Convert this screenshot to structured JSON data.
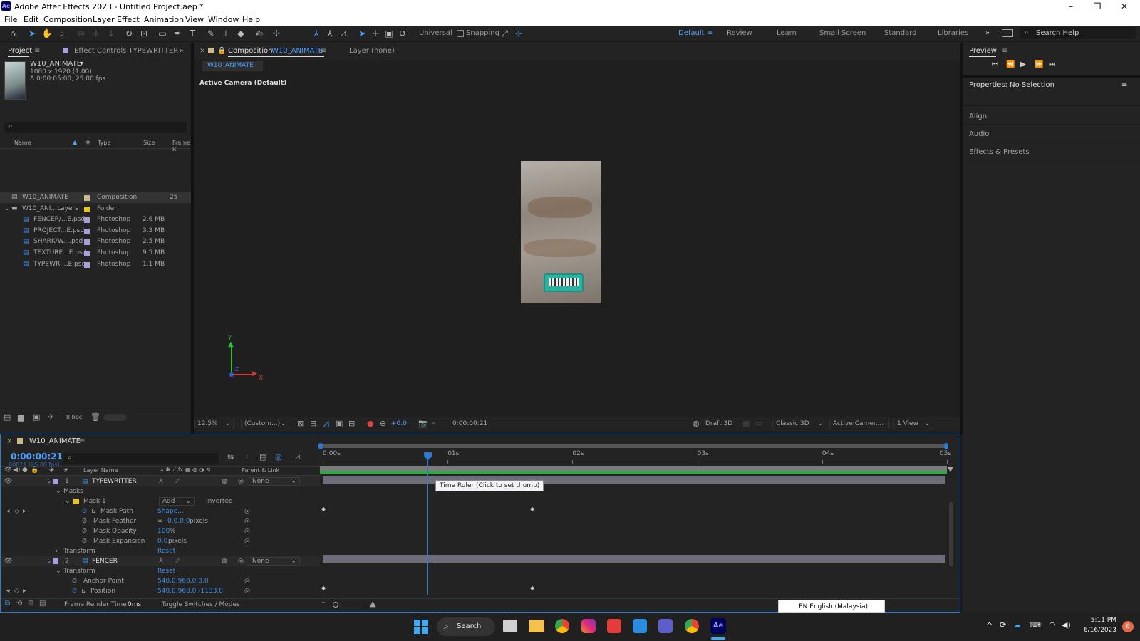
{
  "app": {
    "title": "Adobe After Effects 2023 - Untitled Project.aep *",
    "logo_text": "Ae"
  },
  "menu": [
    "File",
    "Edit",
    "Composition",
    "Layer",
    "Effect",
    "Animation",
    "View",
    "Window",
    "Help"
  ],
  "toolbar": {
    "axis_mode": "Universal",
    "snapping_label": "Snapping",
    "workspaces": [
      "Default",
      "Review",
      "Learn",
      "Small Screen",
      "Standard",
      "Libraries"
    ],
    "active_workspace": "Default",
    "search_placeholder": "Search Help"
  },
  "project_panel": {
    "tab_project": "Project",
    "tab_effect_controls": "Effect Controls TYPEWRITTER",
    "comp_name": "W10_ANIMATE",
    "comp_size": "1080 x 1920 (1.00)",
    "comp_duration": "Δ 0:00:05:00, 25.00 fps",
    "columns": {
      "name": "Name",
      "type": "Type",
      "size": "Size",
      "frame": "Frame R"
    },
    "items": [
      {
        "name": "W10_ANIMATE",
        "type": "Composition",
        "size": "",
        "extra": "25",
        "color": "#c9b98a"
      },
      {
        "name": "W10_ANI.. Layers",
        "type": "Folder",
        "size": "",
        "extra": "",
        "color": "#e8c61f"
      },
      {
        "name": "FENCER/...E.psd",
        "type": "Photoshop",
        "size": "2.6 MB",
        "extra": "",
        "color": "#a79fd9"
      },
      {
        "name": "PROJECT...E.psd",
        "type": "Photoshop",
        "size": "3.3 MB",
        "extra": "",
        "color": "#a79fd9"
      },
      {
        "name": "SHARK/W....psd",
        "type": "Photoshop",
        "size": "2.5 MB",
        "extra": "",
        "color": "#a79fd9"
      },
      {
        "name": "TEXTURE...E.psd",
        "type": "Photoshop",
        "size": "9.5 MB",
        "extra": "",
        "color": "#a79fd9"
      },
      {
        "name": "TYPEWRI...E.psd",
        "type": "Photoshop",
        "size": "1.1 MB",
        "extra": "",
        "color": "#a79fd9"
      }
    ],
    "bpc": "8 bpc"
  },
  "composition_panel": {
    "tab_label": "Composition",
    "tab_comp": "W10_ANIMATE",
    "layer_tab": "Layer (none)",
    "breadcrumb": "W10_ANIMATE",
    "camera_label": "Active Camera (Default)",
    "zoom": "12.5%",
    "resolution": "(Custom...)",
    "exposure": "+0.0",
    "timecode": "0:00:00:21",
    "draft3d": "Draft 3D",
    "renderer": "Classic 3D",
    "view_camera": "Active Camer...",
    "views": "1 View",
    "axis": {
      "x": "X",
      "y": "Y",
      "z": "Z"
    }
  },
  "right_panel": {
    "preview_title": "Preview",
    "properties_title": "Properties: No Selection",
    "sections": [
      "Align",
      "Audio",
      "Effects & Presets"
    ]
  },
  "timeline": {
    "comp_tab": "W10_ANIMATE",
    "timecode": "0:00:00:21",
    "frames_info": "00021 (25.00 fps)",
    "header": {
      "layer_name": "Layer Name",
      "parent": "Parent & Link",
      "num": "#"
    },
    "ruler_ticks": [
      "0:00s",
      "01s",
      "02s",
      "03s",
      "04s",
      "05s"
    ],
    "playhead_fraction": 0.168,
    "tooltip": "Time Ruler (Click to set thumb)",
    "rows": [
      {
        "kind": "layer",
        "num": "1",
        "name": "TYPEWRITTER",
        "parent": "None"
      },
      {
        "kind": "group",
        "name": "Masks"
      },
      {
        "kind": "mask",
        "name": "Mask 1",
        "mode": "Add",
        "inverted": "Inverted"
      },
      {
        "kind": "prop",
        "name": "Mask Path",
        "value": "Shape..."
      },
      {
        "kind": "prop",
        "name": "Mask Feather",
        "value": "0.0,0.0",
        "unit": "pixels"
      },
      {
        "kind": "prop",
        "name": "Mask Opacity",
        "value": "100",
        "unit": "%"
      },
      {
        "kind": "prop",
        "name": "Mask Expansion",
        "value": "0.0",
        "unit": "pixels"
      },
      {
        "kind": "group",
        "name": "Transform",
        "value": "Reset"
      },
      {
        "kind": "layer",
        "num": "2",
        "name": "FENCER",
        "parent": "None"
      },
      {
        "kind": "group",
        "name": "Transform",
        "value": "Reset"
      },
      {
        "kind": "prop",
        "name": "Anchor Point",
        "value": "540.0,960.0,0.0"
      },
      {
        "kind": "prop",
        "name": "Position",
        "value": "540.0,960.0,-1133.0"
      }
    ],
    "footer_render": "Frame Render Time:",
    "footer_render_value": "0ms",
    "footer_toggle": "Toggle Switches / Modes"
  },
  "language_popup": "EN English (Malaysia)",
  "taskbar": {
    "search": "Search",
    "time": "5:11 PM",
    "date": "6/16/2023",
    "notifications": "6"
  }
}
